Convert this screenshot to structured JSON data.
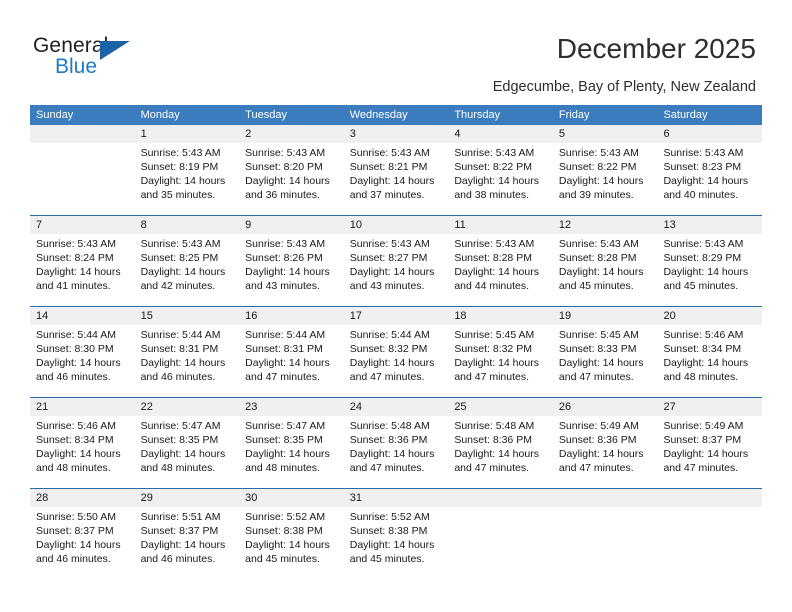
{
  "brand": {
    "name_part1": "General",
    "name_part2": "Blue",
    "accent_color": "#1f7cc4",
    "triangle_color": "#1b62a6",
    "triangle_icon": "blue-triangle-icon"
  },
  "header": {
    "title": "December 2025",
    "subtitle": "Edgecumbe, Bay of Plenty, New Zealand"
  },
  "calendar": {
    "header_bg": "#3b7cbe",
    "header_text_color": "#ffffff",
    "daynum_bg": "#f0f0f0",
    "row_divider_color": "#2d6ca8",
    "weekdays": [
      "Sunday",
      "Monday",
      "Tuesday",
      "Wednesday",
      "Thursday",
      "Friday",
      "Saturday"
    ],
    "weeks": [
      {
        "days": [
          {
            "num": "",
            "lines": []
          },
          {
            "num": "1",
            "lines": [
              "Sunrise: 5:43 AM",
              "Sunset: 8:19 PM",
              "Daylight: 14 hours",
              "and 35 minutes."
            ]
          },
          {
            "num": "2",
            "lines": [
              "Sunrise: 5:43 AM",
              "Sunset: 8:20 PM",
              "Daylight: 14 hours",
              "and 36 minutes."
            ]
          },
          {
            "num": "3",
            "lines": [
              "Sunrise: 5:43 AM",
              "Sunset: 8:21 PM",
              "Daylight: 14 hours",
              "and 37 minutes."
            ]
          },
          {
            "num": "4",
            "lines": [
              "Sunrise: 5:43 AM",
              "Sunset: 8:22 PM",
              "Daylight: 14 hours",
              "and 38 minutes."
            ]
          },
          {
            "num": "5",
            "lines": [
              "Sunrise: 5:43 AM",
              "Sunset: 8:22 PM",
              "Daylight: 14 hours",
              "and 39 minutes."
            ]
          },
          {
            "num": "6",
            "lines": [
              "Sunrise: 5:43 AM",
              "Sunset: 8:23 PM",
              "Daylight: 14 hours",
              "and 40 minutes."
            ]
          }
        ]
      },
      {
        "days": [
          {
            "num": "7",
            "lines": [
              "Sunrise: 5:43 AM",
              "Sunset: 8:24 PM",
              "Daylight: 14 hours",
              "and 41 minutes."
            ]
          },
          {
            "num": "8",
            "lines": [
              "Sunrise: 5:43 AM",
              "Sunset: 8:25 PM",
              "Daylight: 14 hours",
              "and 42 minutes."
            ]
          },
          {
            "num": "9",
            "lines": [
              "Sunrise: 5:43 AM",
              "Sunset: 8:26 PM",
              "Daylight: 14 hours",
              "and 43 minutes."
            ]
          },
          {
            "num": "10",
            "lines": [
              "Sunrise: 5:43 AM",
              "Sunset: 8:27 PM",
              "Daylight: 14 hours",
              "and 43 minutes."
            ]
          },
          {
            "num": "11",
            "lines": [
              "Sunrise: 5:43 AM",
              "Sunset: 8:28 PM",
              "Daylight: 14 hours",
              "and 44 minutes."
            ]
          },
          {
            "num": "12",
            "lines": [
              "Sunrise: 5:43 AM",
              "Sunset: 8:28 PM",
              "Daylight: 14 hours",
              "and 45 minutes."
            ]
          },
          {
            "num": "13",
            "lines": [
              "Sunrise: 5:43 AM",
              "Sunset: 8:29 PM",
              "Daylight: 14 hours",
              "and 45 minutes."
            ]
          }
        ]
      },
      {
        "days": [
          {
            "num": "14",
            "lines": [
              "Sunrise: 5:44 AM",
              "Sunset: 8:30 PM",
              "Daylight: 14 hours",
              "and 46 minutes."
            ]
          },
          {
            "num": "15",
            "lines": [
              "Sunrise: 5:44 AM",
              "Sunset: 8:31 PM",
              "Daylight: 14 hours",
              "and 46 minutes."
            ]
          },
          {
            "num": "16",
            "lines": [
              "Sunrise: 5:44 AM",
              "Sunset: 8:31 PM",
              "Daylight: 14 hours",
              "and 47 minutes."
            ]
          },
          {
            "num": "17",
            "lines": [
              "Sunrise: 5:44 AM",
              "Sunset: 8:32 PM",
              "Daylight: 14 hours",
              "and 47 minutes."
            ]
          },
          {
            "num": "18",
            "lines": [
              "Sunrise: 5:45 AM",
              "Sunset: 8:32 PM",
              "Daylight: 14 hours",
              "and 47 minutes."
            ]
          },
          {
            "num": "19",
            "lines": [
              "Sunrise: 5:45 AM",
              "Sunset: 8:33 PM",
              "Daylight: 14 hours",
              "and 47 minutes."
            ]
          },
          {
            "num": "20",
            "lines": [
              "Sunrise: 5:46 AM",
              "Sunset: 8:34 PM",
              "Daylight: 14 hours",
              "and 48 minutes."
            ]
          }
        ]
      },
      {
        "days": [
          {
            "num": "21",
            "lines": [
              "Sunrise: 5:46 AM",
              "Sunset: 8:34 PM",
              "Daylight: 14 hours",
              "and 48 minutes."
            ]
          },
          {
            "num": "22",
            "lines": [
              "Sunrise: 5:47 AM",
              "Sunset: 8:35 PM",
              "Daylight: 14 hours",
              "and 48 minutes."
            ]
          },
          {
            "num": "23",
            "lines": [
              "Sunrise: 5:47 AM",
              "Sunset: 8:35 PM",
              "Daylight: 14 hours",
              "and 48 minutes."
            ]
          },
          {
            "num": "24",
            "lines": [
              "Sunrise: 5:48 AM",
              "Sunset: 8:36 PM",
              "Daylight: 14 hours",
              "and 47 minutes."
            ]
          },
          {
            "num": "25",
            "lines": [
              "Sunrise: 5:48 AM",
              "Sunset: 8:36 PM",
              "Daylight: 14 hours",
              "and 47 minutes."
            ]
          },
          {
            "num": "26",
            "lines": [
              "Sunrise: 5:49 AM",
              "Sunset: 8:36 PM",
              "Daylight: 14 hours",
              "and 47 minutes."
            ]
          },
          {
            "num": "27",
            "lines": [
              "Sunrise: 5:49 AM",
              "Sunset: 8:37 PM",
              "Daylight: 14 hours",
              "and 47 minutes."
            ]
          }
        ]
      },
      {
        "days": [
          {
            "num": "28",
            "lines": [
              "Sunrise: 5:50 AM",
              "Sunset: 8:37 PM",
              "Daylight: 14 hours",
              "and 46 minutes."
            ]
          },
          {
            "num": "29",
            "lines": [
              "Sunrise: 5:51 AM",
              "Sunset: 8:37 PM",
              "Daylight: 14 hours",
              "and 46 minutes."
            ]
          },
          {
            "num": "30",
            "lines": [
              "Sunrise: 5:52 AM",
              "Sunset: 8:38 PM",
              "Daylight: 14 hours",
              "and 45 minutes."
            ]
          },
          {
            "num": "31",
            "lines": [
              "Sunrise: 5:52 AM",
              "Sunset: 8:38 PM",
              "Daylight: 14 hours",
              "and 45 minutes."
            ]
          },
          {
            "num": "",
            "lines": []
          },
          {
            "num": "",
            "lines": []
          },
          {
            "num": "",
            "lines": []
          }
        ]
      }
    ]
  }
}
